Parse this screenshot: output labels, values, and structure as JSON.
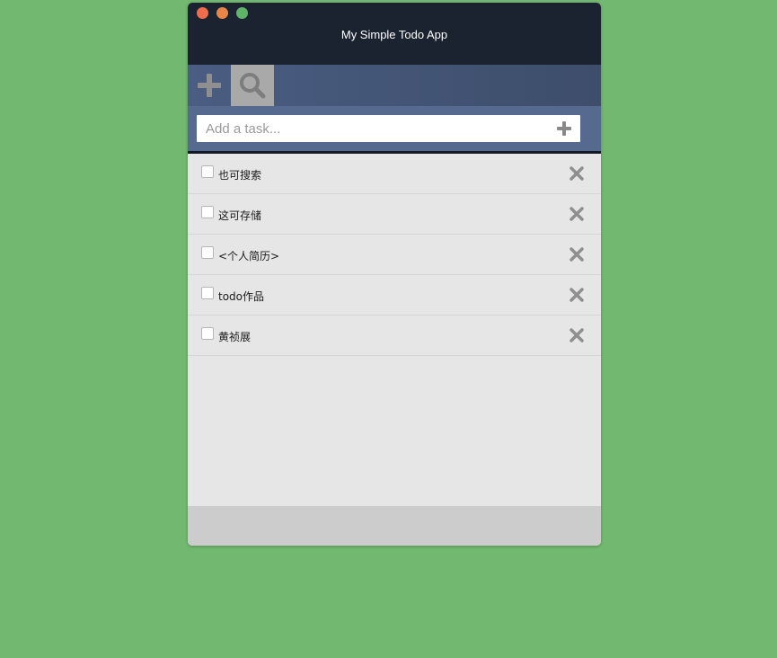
{
  "window": {
    "title": "My Simple Todo App"
  },
  "toolbar": {
    "add_icon": "plus-icon",
    "search_icon": "search-icon"
  },
  "input": {
    "placeholder": "Add a task...",
    "value": "",
    "add_icon": "plus-icon"
  },
  "todos": [
    {
      "label": "也可搜索",
      "checked": false
    },
    {
      "label": "这可存储",
      "checked": false
    },
    {
      "label": "<个人简历>",
      "checked": false
    },
    {
      "label": "todo作品",
      "checked": false
    },
    {
      "label": "黄祯展",
      "checked": false
    }
  ],
  "colors": {
    "background": "#72b870",
    "titlebar": "#1b2330",
    "toolbar": "#4a5d82",
    "input_bar": "#56698e",
    "list_bg": "#e6e6e6",
    "footer": "#cccccc",
    "icon_gray": "#8f8f8f"
  }
}
